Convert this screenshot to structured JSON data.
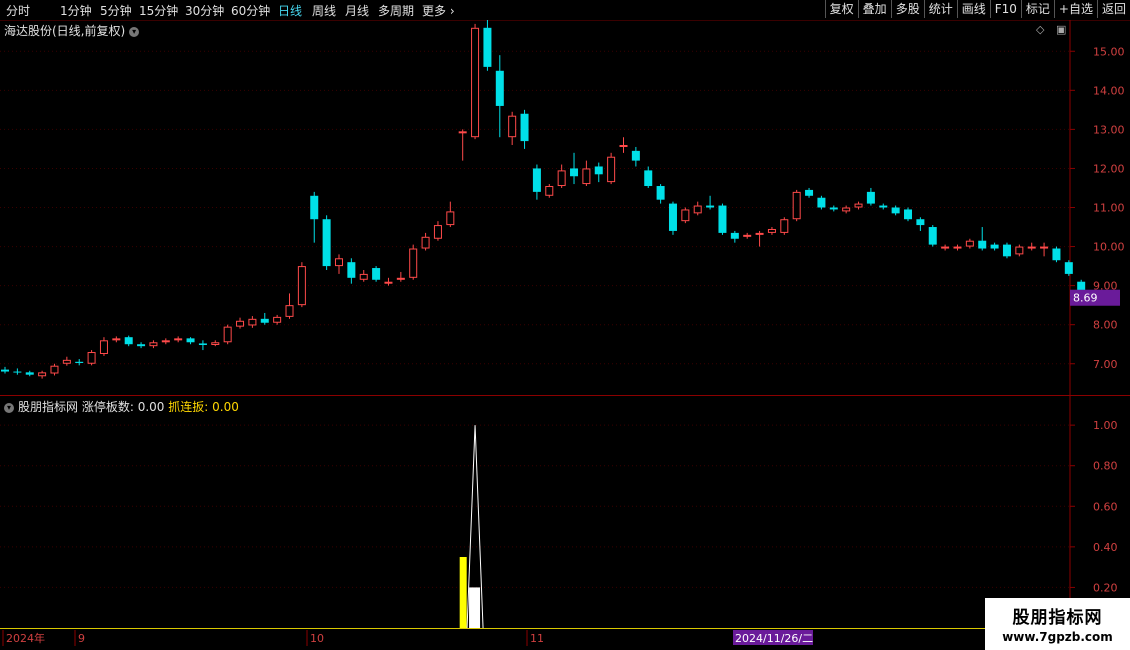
{
  "toolbar": {
    "periods": [
      "分时",
      "1分钟",
      "5分钟",
      "15分钟",
      "30分钟",
      "60分钟",
      "日线",
      "周线",
      "月线",
      "多周期",
      "更多"
    ],
    "active_period": "日线",
    "right_buttons": [
      "复权",
      "叠加",
      "多股",
      "统计",
      "画线",
      "F10",
      "标记",
      "+自选",
      "返回"
    ]
  },
  "chart": {
    "title": "海达股份(日线,前复权)",
    "price_ticks": [
      "15.00",
      "14.00",
      "13.00",
      "12.00",
      "11.00",
      "10.00",
      "9.00",
      "8.00",
      "7.00"
    ],
    "current_price": "8.69"
  },
  "indicator": {
    "name": "股朋指标网",
    "field1_label": "涨停板数:",
    "field1_value": "0.00",
    "field2_label": "抓连扳:",
    "field2_value": "0.00",
    "ticks": [
      "1.00",
      "0.80",
      "0.60",
      "0.40",
      "0.20"
    ]
  },
  "xaxis": {
    "labels": [
      "2024年",
      "9",
      "10",
      "11"
    ],
    "cursor_date": "2024/11/26/二"
  },
  "watermark": {
    "line1": "股朋指标网",
    "line2": "www.7gpzb.com"
  },
  "colors": {
    "up": "#ff4a4a",
    "down": "#00e0e8",
    "axis": "#8b0000",
    "grid": "#3a0000",
    "highlight": "#6a1b9a"
  },
  "chart_data": {
    "type": "candlestick",
    "title": "海达股份(日线,前复权)",
    "price_ylim": [
      6.2,
      15.8
    ],
    "candles": [
      [
        6.85,
        6.8,
        6.92,
        6.75
      ],
      [
        6.8,
        6.78,
        6.88,
        6.72
      ],
      [
        6.78,
        6.72,
        6.82,
        6.68
      ],
      [
        6.68,
        6.78,
        6.82,
        6.62
      ],
      [
        6.75,
        6.95,
        7.0,
        6.7
      ],
      [
        7.0,
        7.1,
        7.18,
        6.95
      ],
      [
        7.05,
        7.02,
        7.12,
        6.96
      ],
      [
        7.0,
        7.3,
        7.35,
        6.96
      ],
      [
        7.25,
        7.6,
        7.68,
        7.2
      ],
      [
        7.6,
        7.65,
        7.7,
        7.55
      ],
      [
        7.68,
        7.5,
        7.72,
        7.45
      ],
      [
        7.5,
        7.45,
        7.55,
        7.4
      ],
      [
        7.45,
        7.55,
        7.6,
        7.4
      ],
      [
        7.55,
        7.6,
        7.65,
        7.5
      ],
      [
        7.6,
        7.65,
        7.7,
        7.55
      ],
      [
        7.65,
        7.55,
        7.68,
        7.5
      ],
      [
        7.52,
        7.48,
        7.6,
        7.35
      ],
      [
        7.48,
        7.55,
        7.6,
        7.45
      ],
      [
        7.55,
        7.95,
        8.0,
        7.5
      ],
      [
        7.95,
        8.1,
        8.18,
        7.9
      ],
      [
        7.98,
        8.15,
        8.22,
        7.92
      ],
      [
        8.15,
        8.05,
        8.3,
        8.0
      ],
      [
        8.05,
        8.2,
        8.25,
        8.0
      ],
      [
        8.2,
        8.5,
        8.8,
        8.15
      ],
      [
        8.5,
        9.5,
        9.6,
        8.45
      ],
      [
        11.3,
        10.7,
        11.4,
        10.1
      ],
      [
        10.7,
        9.5,
        10.8,
        9.4
      ],
      [
        9.5,
        9.7,
        9.8,
        9.3
      ],
      [
        9.6,
        9.2,
        9.7,
        9.05
      ],
      [
        9.15,
        9.3,
        9.4,
        9.1
      ],
      [
        9.45,
        9.15,
        9.5,
        9.1
      ],
      [
        9.1,
        9.1,
        9.2,
        9.0
      ],
      [
        9.15,
        9.2,
        9.35,
        9.1
      ],
      [
        9.2,
        9.95,
        10.05,
        9.15
      ],
      [
        9.95,
        10.25,
        10.35,
        9.9
      ],
      [
        10.2,
        10.55,
        10.65,
        10.15
      ],
      [
        10.55,
        10.9,
        11.15,
        10.5
      ],
      [
        12.9,
        12.95,
        13.0,
        12.2
      ],
      [
        12.8,
        15.6,
        15.7,
        12.75
      ],
      [
        15.6,
        14.6,
        15.8,
        14.5
      ],
      [
        14.5,
        13.6,
        14.9,
        12.8
      ],
      [
        12.8,
        13.35,
        13.45,
        12.6
      ],
      [
        13.4,
        12.7,
        13.5,
        12.5
      ],
      [
        12.0,
        11.4,
        12.1,
        11.2
      ],
      [
        11.3,
        11.55,
        11.6,
        11.25
      ],
      [
        11.55,
        11.95,
        12.1,
        11.5
      ],
      [
        12.0,
        11.8,
        12.4,
        11.6
      ],
      [
        11.6,
        12.0,
        12.2,
        11.55
      ],
      [
        12.05,
        11.85,
        12.15,
        11.65
      ],
      [
        11.65,
        12.3,
        12.4,
        11.6
      ],
      [
        12.6,
        12.6,
        12.8,
        12.4
      ],
      [
        12.45,
        12.2,
        12.55,
        12.05
      ],
      [
        11.95,
        11.55,
        12.05,
        11.5
      ],
      [
        11.55,
        11.2,
        11.6,
        11.1
      ],
      [
        11.1,
        10.4,
        11.15,
        10.3
      ],
      [
        10.65,
        10.95,
        11.0,
        10.6
      ],
      [
        10.85,
        11.05,
        11.15,
        10.8
      ],
      [
        11.05,
        11.0,
        11.3,
        10.95
      ],
      [
        11.05,
        10.35,
        11.1,
        10.3
      ],
      [
        10.35,
        10.2,
        10.4,
        10.1
      ],
      [
        10.25,
        10.3,
        10.35,
        10.2
      ],
      [
        10.3,
        10.35,
        10.4,
        10.0
      ],
      [
        10.35,
        10.45,
        10.5,
        10.3
      ],
      [
        10.35,
        10.7,
        10.75,
        10.3
      ],
      [
        10.7,
        11.4,
        11.45,
        10.65
      ],
      [
        11.45,
        11.3,
        11.5,
        11.25
      ],
      [
        11.25,
        11.0,
        11.3,
        10.95
      ],
      [
        11.0,
        10.95,
        11.05,
        10.9
      ],
      [
        10.9,
        11.0,
        11.05,
        10.85
      ],
      [
        11.0,
        11.1,
        11.15,
        10.95
      ],
      [
        11.4,
        11.1,
        11.5,
        11.05
      ],
      [
        11.05,
        11.0,
        11.1,
        10.95
      ],
      [
        11.0,
        10.85,
        11.05,
        10.8
      ],
      [
        10.95,
        10.7,
        11.0,
        10.65
      ],
      [
        10.7,
        10.55,
        10.75,
        10.4
      ],
      [
        10.5,
        10.05,
        10.55,
        10.0
      ],
      [
        10.0,
        10.0,
        10.05,
        9.9
      ],
      [
        9.95,
        10.0,
        10.05,
        9.9
      ],
      [
        10.0,
        10.15,
        10.2,
        9.95
      ],
      [
        10.15,
        9.95,
        10.5,
        9.9
      ],
      [
        10.05,
        9.95,
        10.1,
        9.9
      ],
      [
        10.05,
        9.75,
        10.1,
        9.7
      ],
      [
        9.8,
        10.0,
        10.05,
        9.75
      ],
      [
        10.0,
        10.0,
        10.1,
        9.9
      ],
      [
        10.0,
        10.0,
        10.1,
        9.75
      ],
      [
        9.95,
        9.65,
        10.0,
        9.6
      ],
      [
        9.6,
        9.3,
        9.65,
        9.25
      ],
      [
        9.1,
        8.75,
        9.15,
        8.7
      ]
    ],
    "indicator": {
      "name": "股朋指标网",
      "ylim": [
        0,
        1.05
      ],
      "series": [
        {
          "name": "涨停板数",
          "bars": [
            {
              "index": 37,
              "value": 0.35
            }
          ]
        },
        {
          "name": "抓连扳",
          "bars": [
            {
              "index": 38,
              "value": 0.2
            }
          ],
          "peak": {
            "index": 38,
            "value": 1.0
          }
        }
      ]
    }
  }
}
